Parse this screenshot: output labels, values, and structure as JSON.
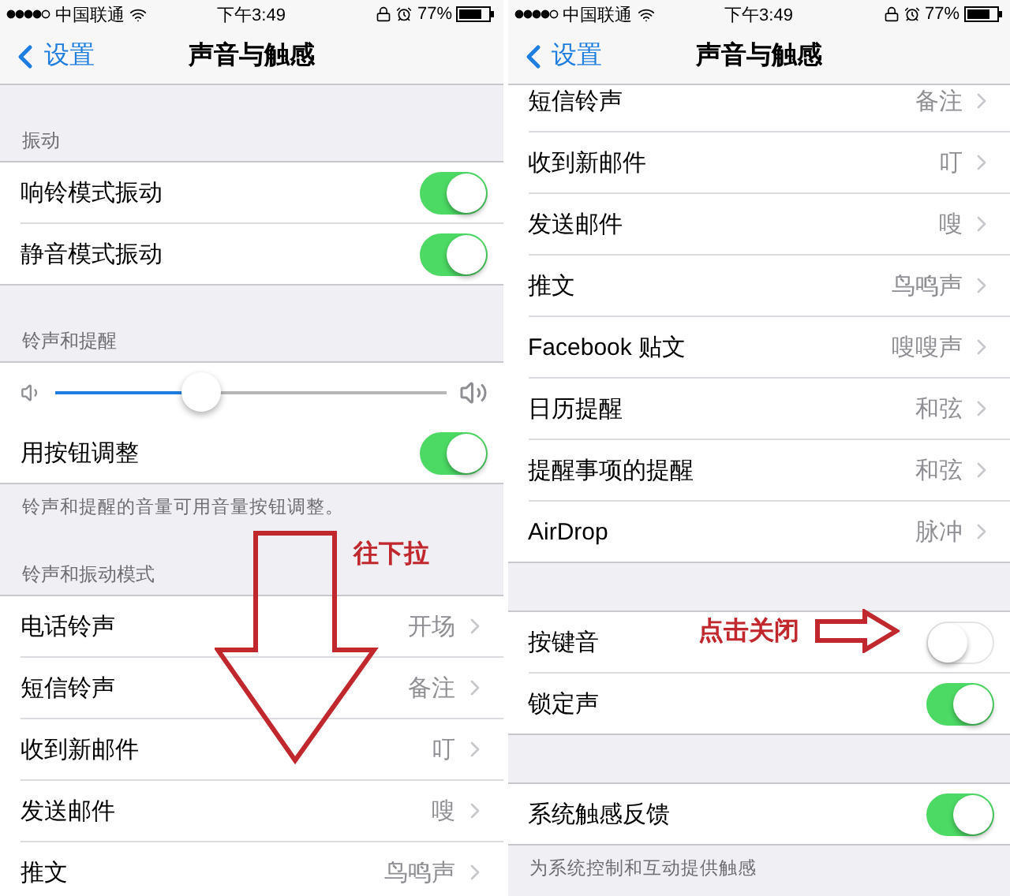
{
  "screens": [
    {
      "status_bar": {
        "carrier": "中国联通",
        "time": "下午3:49",
        "battery": "77%"
      },
      "nav": {
        "back": "设置",
        "title": "声音与触感"
      },
      "scrolled": false,
      "sections": [
        {
          "header": "振动",
          "rows": [
            {
              "kind": "toggle",
              "label": "响铃模式振动",
              "on": true
            },
            {
              "kind": "toggle",
              "label": "静音模式振动",
              "on": true
            }
          ]
        },
        {
          "header": "铃声和提醒",
          "rows": [
            {
              "kind": "slider",
              "level": 0.37
            },
            {
              "kind": "toggle",
              "label": "用按钮调整",
              "on": true
            }
          ],
          "footer": "铃声和提醒的音量可用音量按钮调整。"
        },
        {
          "header": "铃声和振动模式",
          "rows": [
            {
              "kind": "link",
              "label": "电话铃声",
              "value": "开场"
            },
            {
              "kind": "link",
              "label": "短信铃声",
              "value": "备注"
            },
            {
              "kind": "link",
              "label": "收到新邮件",
              "value": "叮"
            },
            {
              "kind": "link",
              "label": "发送邮件",
              "value": "嗖"
            },
            {
              "kind": "link",
              "label": "推文",
              "value": "鸟鸣声"
            }
          ]
        }
      ],
      "annotation": {
        "kind": "down",
        "text": "往下拉"
      }
    },
    {
      "status_bar": {
        "carrier": "中国联通",
        "time": "下午3:49",
        "battery": "77%"
      },
      "nav": {
        "back": "设置",
        "title": "声音与触感"
      },
      "scrolled": true,
      "sections": [
        {
          "rows": [
            {
              "kind": "link",
              "label": "短信铃声",
              "value": "备注"
            },
            {
              "kind": "link",
              "label": "收到新邮件",
              "value": "叮"
            },
            {
              "kind": "link",
              "label": "发送邮件",
              "value": "嗖"
            },
            {
              "kind": "link",
              "label": "推文",
              "value": "鸟鸣声"
            },
            {
              "kind": "link",
              "label": "Facebook 贴文",
              "value": "嗖嗖声"
            },
            {
              "kind": "link",
              "label": "日历提醒",
              "value": "和弦"
            },
            {
              "kind": "link",
              "label": "提醒事项的提醒",
              "value": "和弦"
            },
            {
              "kind": "link",
              "label": "AirDrop",
              "value": "脉冲"
            }
          ]
        },
        {
          "rows": [
            {
              "kind": "toggle",
              "label": "按键音",
              "on": false
            },
            {
              "kind": "toggle",
              "label": "锁定声",
              "on": true
            }
          ]
        },
        {
          "rows": [
            {
              "kind": "toggle",
              "label": "系统触感反馈",
              "on": true
            }
          ],
          "footer": "为系统控制和互动提供触感"
        }
      ],
      "annotation": {
        "kind": "right",
        "text": "点击关闭"
      }
    }
  ]
}
